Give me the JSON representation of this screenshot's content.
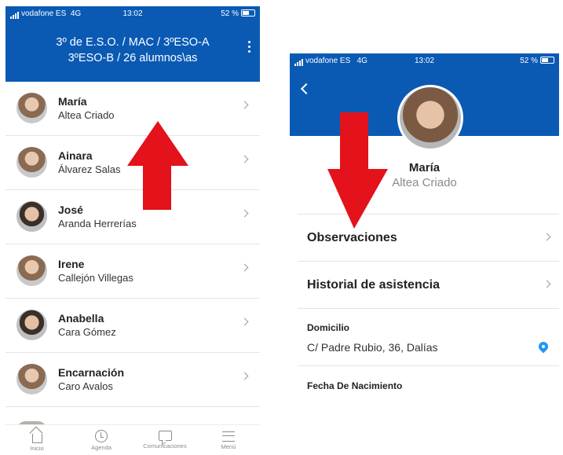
{
  "left": {
    "status": {
      "carrier": "vodafone ES",
      "network": "4G",
      "time": "13:02",
      "battery": "52 %"
    },
    "header": {
      "title_line1": "3º de E.S.O. / MAC / 3ºESO-A",
      "title_line2": "3ºESO-B / 26 alumnos\\as"
    },
    "students": [
      {
        "first": "María",
        "last": "Altea Criado",
        "avatar": "girl"
      },
      {
        "first": "Ainara",
        "last": "Álvarez Salas",
        "avatar": "girl"
      },
      {
        "first": "José",
        "last": "Aranda Herrerías",
        "avatar": "boy"
      },
      {
        "first": "Irene",
        "last": "Callejón Villegas",
        "avatar": "girl"
      },
      {
        "first": "Anabella",
        "last": "Cara Gómez",
        "avatar": "boy"
      },
      {
        "first": "Encarnación",
        "last": "Caro Avalos",
        "avatar": "girl"
      }
    ],
    "tabs": [
      {
        "label": "Inicio",
        "icon": "home-icon"
      },
      {
        "label": "Agenda",
        "icon": "clock-icon"
      },
      {
        "label": "Comunicaciones",
        "icon": "chat-icon"
      },
      {
        "label": "Menú",
        "icon": "menu-icon"
      }
    ]
  },
  "right": {
    "status": {
      "carrier": "vodafone ES",
      "network": "4G",
      "time": "13:02",
      "battery": "52 %"
    },
    "profile": {
      "first": "María",
      "last": "Altea Criado"
    },
    "rows": [
      {
        "label": "Observaciones"
      },
      {
        "label": "Historial de asistencia"
      }
    ],
    "address": {
      "label": "Domicilio",
      "value": "C/ Padre Rubio, 36, Dalías",
      "icon": "map-pin-icon"
    },
    "birthdate": {
      "label": "Fecha De Nacimiento"
    }
  },
  "colors": {
    "header_blue": "#0a5ab4",
    "arrow_red": "#e3121b",
    "pin_blue": "#2196f3"
  }
}
